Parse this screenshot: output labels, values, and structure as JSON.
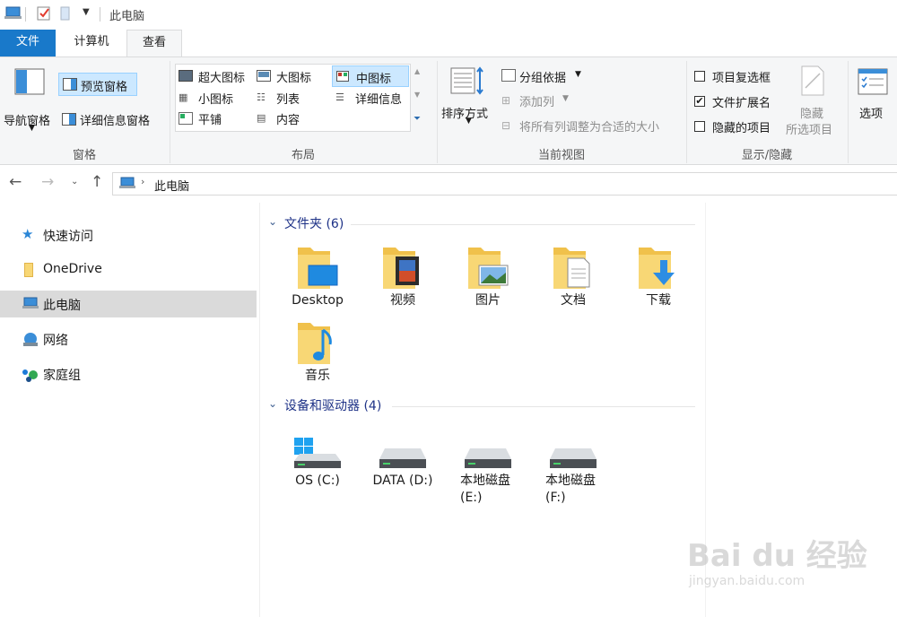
{
  "window": {
    "title": "此电脑"
  },
  "tabs": {
    "file": "文件",
    "computer": "计算机",
    "view": "查看"
  },
  "ribbon": {
    "panes": {
      "nav_pane": "导航窗格",
      "preview_pane": "预览窗格",
      "details_pane": "详细信息窗格",
      "label": "窗格"
    },
    "layout": {
      "extra_large": "超大图标",
      "large": "大图标",
      "medium": "中图标",
      "small": "小图标",
      "list": "列表",
      "details": "详细信息",
      "tiles": "平铺",
      "content": "内容",
      "label": "布局"
    },
    "current_view": {
      "sort_by": "排序方式",
      "group_by": "分组依据",
      "add_columns": "添加列",
      "size_all_columns": "将所有列调整为合适的大小",
      "label": "当前视图"
    },
    "show_hide": {
      "item_checkboxes": "项目复选框",
      "file_extensions": "文件扩展名",
      "hidden_items": "隐藏的项目",
      "hide_selected_line1": "隐藏",
      "hide_selected_line2": "所选项目",
      "label": "显示/隐藏",
      "item_checkboxes_checked": false,
      "file_extensions_checked": true,
      "hidden_items_checked": false
    },
    "options": "选项"
  },
  "address": {
    "path_root": "此电脑"
  },
  "sidebar": {
    "items": [
      {
        "label": "快速访问"
      },
      {
        "label": "OneDrive"
      },
      {
        "label": "此电脑"
      },
      {
        "label": "网络"
      },
      {
        "label": "家庭组"
      }
    ]
  },
  "folders": {
    "header": "文件夹 (6)",
    "items": [
      {
        "label": "Desktop"
      },
      {
        "label": "视频"
      },
      {
        "label": "图片"
      },
      {
        "label": "文档"
      },
      {
        "label": "下载"
      },
      {
        "label": "音乐"
      }
    ]
  },
  "drives": {
    "header": "设备和驱动器 (4)",
    "items": [
      {
        "label": "OS (C:)"
      },
      {
        "label": "DATA (D:)"
      },
      {
        "label": "本地磁盘",
        "sub": "(E:)"
      },
      {
        "label": "本地磁盘",
        "sub": "(F:)"
      }
    ]
  },
  "watermark": {
    "brand": "Bai du 经验",
    "url": "jingyan.baidu.com"
  },
  "colors": {
    "accent": "#1979ca",
    "folder": "#f8d775",
    "folder_dark": "#e8b84a",
    "header_text": "#1e3287"
  }
}
